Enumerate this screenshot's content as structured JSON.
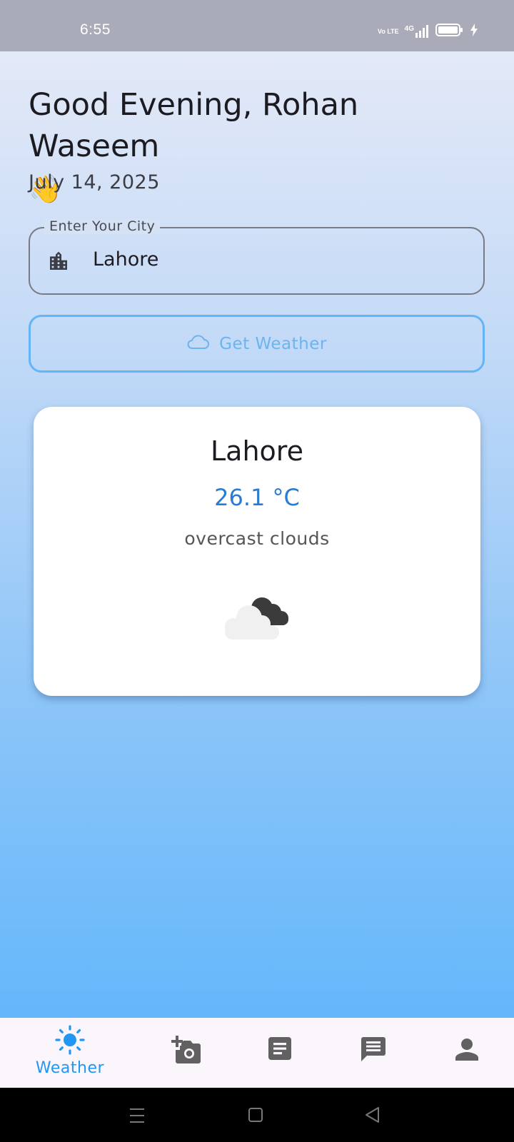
{
  "status_bar": {
    "time": "6:55",
    "network_label": "4G",
    "volte_label": "Vo LTE"
  },
  "greeting": {
    "text": "Good Evening, Rohan Waseem",
    "emoji": "👋"
  },
  "date": "July 14, 2025",
  "city_input": {
    "label": "Enter Your City",
    "value": "Lahore",
    "icon": "city-buildings-icon"
  },
  "get_weather_button": {
    "label": "Get Weather",
    "icon": "cloud-outline-icon"
  },
  "weather_card": {
    "city": "Lahore",
    "temperature": "26.1 °C",
    "description": "overcast clouds",
    "icon": "overcast-clouds-icon"
  },
  "bottom_nav": {
    "items": [
      {
        "label": "Weather",
        "icon": "sun-icon",
        "active": true
      },
      {
        "label": "",
        "icon": "add-photo-icon",
        "active": false
      },
      {
        "label": "",
        "icon": "document-icon",
        "active": false
      },
      {
        "label": "",
        "icon": "chat-icon",
        "active": false
      },
      {
        "label": "",
        "icon": "profile-icon",
        "active": false
      }
    ]
  },
  "colors": {
    "accent": "#2196f3",
    "temperature": "#2a7bd3",
    "button_border": "#64b5f6",
    "nav_inactive": "#616161"
  }
}
